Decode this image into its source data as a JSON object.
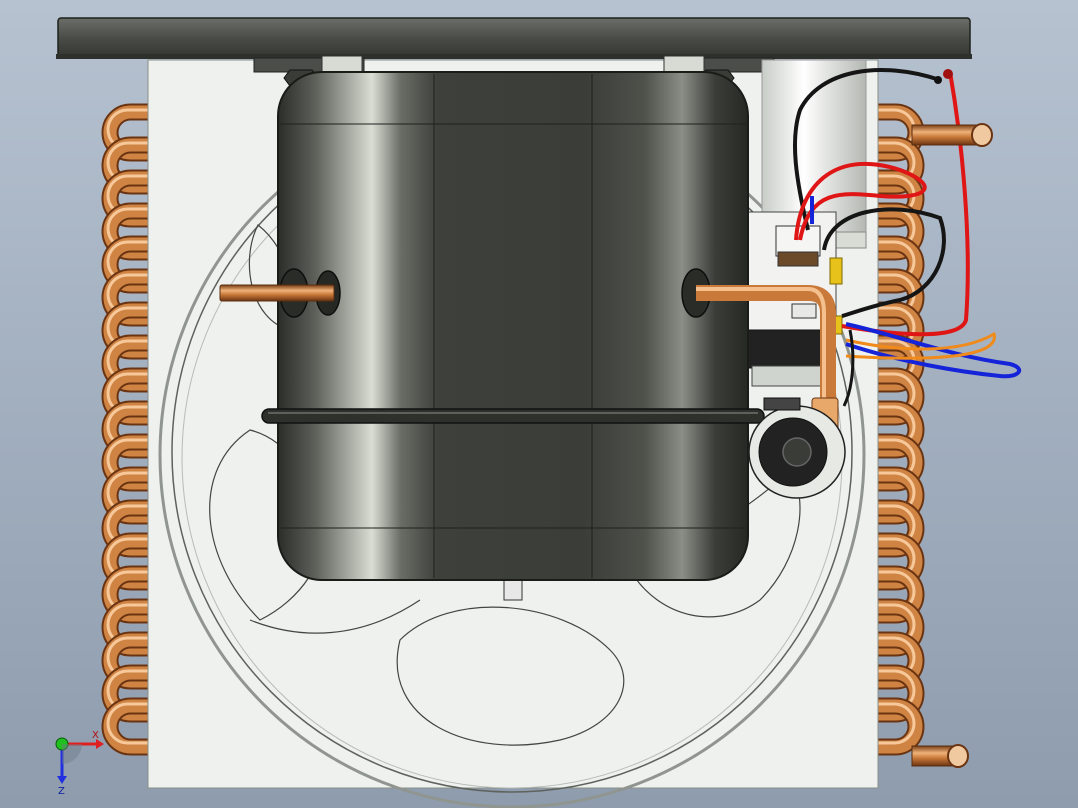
{
  "viewport": {
    "background_top": "#b6c2d0",
    "background_bottom": "#8e9cae"
  },
  "colors": {
    "copper": "#c9793a",
    "copper_light": "#f0b27a",
    "copper_dark": "#7a3f16",
    "compressor_body": "#3d403b",
    "chassis_plate": "#4a4c48",
    "panel": "#eef1ee",
    "wire_red": "#e01515",
    "wire_blue": "#1524d8",
    "wire_black": "#151515",
    "wire_orange": "#f08a1a",
    "axis_x": "#e02020",
    "axis_y": "#20c020",
    "axis_z": "#2030e0"
  },
  "triad": {
    "x_label": "X",
    "z_label": "Z"
  }
}
